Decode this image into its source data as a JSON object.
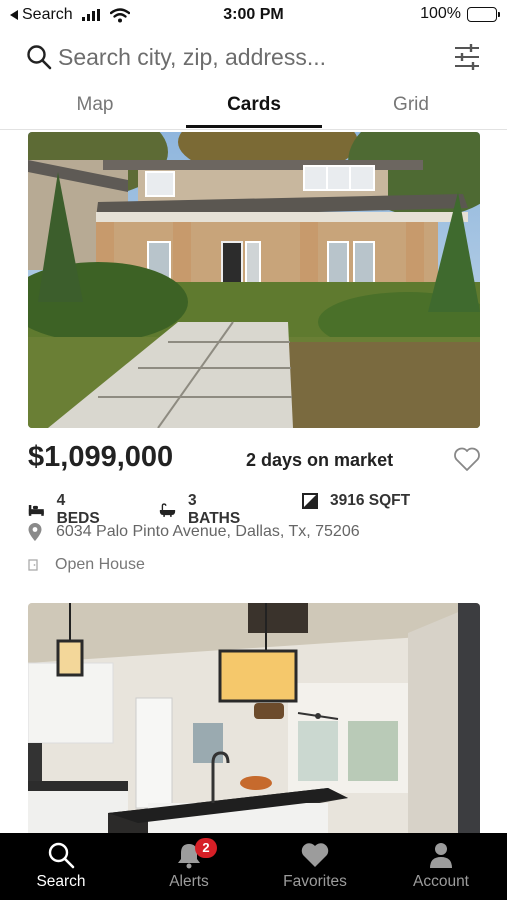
{
  "status_bar": {
    "back_label": "Search",
    "time": "3:00 PM",
    "battery": "100%"
  },
  "search": {
    "placeholder": "Search city, zip, address..."
  },
  "view_tabs": [
    {
      "label": "Map",
      "active": false
    },
    {
      "label": "Cards",
      "active": true
    },
    {
      "label": "Grid",
      "active": false
    }
  ],
  "listings": [
    {
      "price": "$1,099,000",
      "days_on_market": "2 days on market",
      "beds": "4 BEDS",
      "baths": "3 BATHS",
      "sqft": "3916 SQFT",
      "address": "6034 Palo Pinto Avenue, Dallas, Tx, 75206",
      "open_house": "Open House",
      "favorited": false
    }
  ],
  "bottom_nav": {
    "search": "Search",
    "alerts": "Alerts",
    "alerts_badge": "2",
    "favorites": "Favorites",
    "account": "Account"
  },
  "colors": {
    "badge": "#d61f26",
    "tabbar_bg": "#000000",
    "active_text": "#111111"
  }
}
